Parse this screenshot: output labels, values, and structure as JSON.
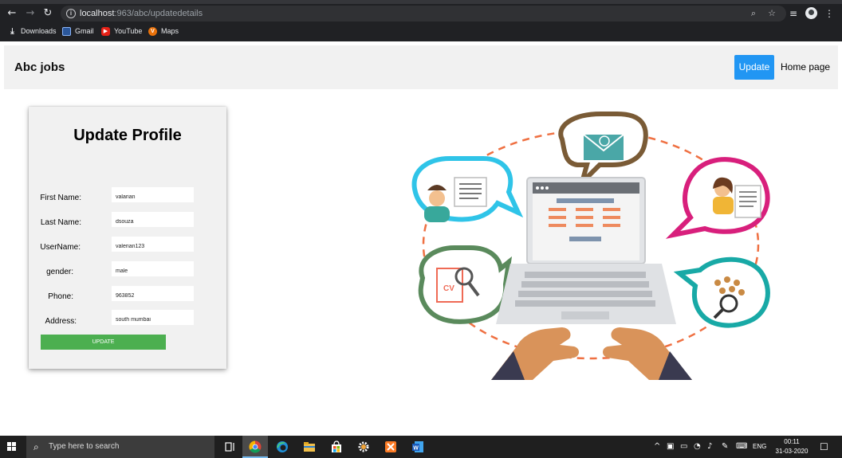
{
  "browser": {
    "url_host": "localhost",
    "url_path": ":963/abc/updatedetails",
    "bookmarks": [
      {
        "label": "Downloads",
        "icon": "download-icon"
      },
      {
        "label": "Gmail",
        "icon": "gmail-icon"
      },
      {
        "label": "YouTube",
        "icon": "youtube-icon"
      },
      {
        "label": "Maps",
        "icon": "maps-icon"
      }
    ]
  },
  "navbar": {
    "brand": "Abc jobs",
    "update_label": "Update",
    "home_label": "Home page",
    "accent_color": "#2196f3"
  },
  "form": {
    "title": "Update Profile",
    "fields": [
      {
        "label": "First Name:",
        "value": "valarian"
      },
      {
        "label": "Last Name:",
        "value": "dsouza"
      },
      {
        "label": "UserName:",
        "value": "valerian123"
      },
      {
        "label": "gender:",
        "value": "male"
      },
      {
        "label": "Phone:",
        "value": "963852"
      },
      {
        "label": "Address:",
        "value": "south mumbai"
      }
    ],
    "submit_label": "UPDATE",
    "submit_color": "#4caf50"
  },
  "taskbar": {
    "search_placeholder": "Type here to search",
    "language": "ENG",
    "time": "00:11",
    "date": "31-03-2020"
  }
}
